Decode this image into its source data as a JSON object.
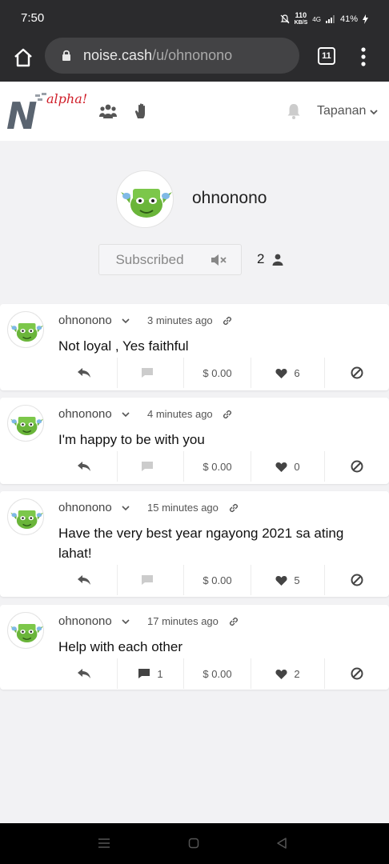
{
  "status": {
    "time": "7:50",
    "net_speed_value": "110",
    "net_speed_unit": "KB/S",
    "net_type": "4G",
    "battery": "41%"
  },
  "browser": {
    "url_host": "noise.cash",
    "url_path": "/u/ohnonono",
    "tab_count": "11",
    "icons": [
      "home-icon",
      "lock-icon",
      "tab-switcher-icon",
      "more-vertical-icon"
    ]
  },
  "header": {
    "logo_letter": "N",
    "logo_tag": "alpha!",
    "nav_icons": [
      "community-icon",
      "hand-icon"
    ],
    "language": "Tapanan"
  },
  "profile": {
    "username": "ohnonono",
    "subscribe_label": "Subscribed",
    "subscriber_count": "2"
  },
  "posts": [
    {
      "author": "ohnonono",
      "time": "3 minutes ago",
      "text": "Not loyal , Yes faithful",
      "comments": "",
      "tips": "$ 0.00",
      "likes": "6"
    },
    {
      "author": "ohnonono",
      "time": "4 minutes ago",
      "text": "I'm happy to be with you",
      "comments": "",
      "tips": "$ 0.00",
      "likes": "0"
    },
    {
      "author": "ohnonono",
      "time": "15 minutes ago",
      "text": "Have the very best year ngayong 2021 sa ating lahat!",
      "comments": "",
      "tips": "$ 0.00",
      "likes": "5"
    },
    {
      "author": "ohnonono",
      "time": "17 minutes ago",
      "text": "Help with each other",
      "comments": "1",
      "tips": "$ 0.00",
      "likes": "2"
    }
  ],
  "colors": {
    "accent_red": "#d01f2a",
    "avatar_green": "#6ab53a",
    "icon_gray": "#555555"
  }
}
